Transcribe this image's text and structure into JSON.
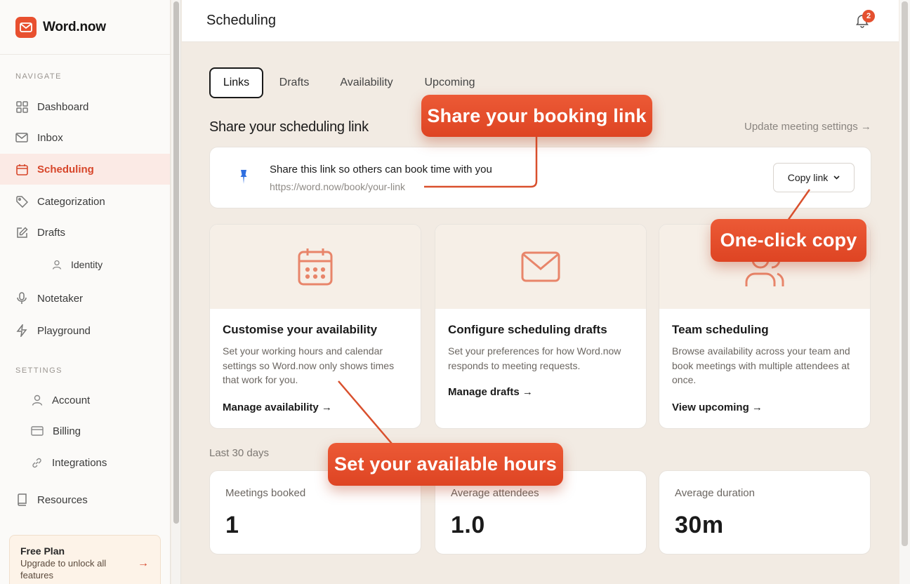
{
  "brand": {
    "name": "Word.now"
  },
  "sidebar": {
    "navigate_label": "NAVIGATE",
    "settings_label": "SETTINGS",
    "items": {
      "dashboard": "Dashboard",
      "inbox": "Inbox",
      "scheduling": "Scheduling",
      "categorization": "Categorization",
      "drafts": "Drafts",
      "identity": "Identity",
      "notetaker": "Notetaker",
      "playground": "Playground",
      "account": "Account",
      "billing": "Billing",
      "integrations": "Integrations",
      "resources": "Resources"
    },
    "free_plan": {
      "title": "Free Plan",
      "subtitle": "Upgrade to unlock all features",
      "arrow": "→"
    }
  },
  "header": {
    "title": "Scheduling",
    "notification_count": "2"
  },
  "tabs": [
    "Links",
    "Drafts",
    "Availability",
    "Upcoming"
  ],
  "share_section": {
    "title": "Share your scheduling link",
    "update_link": "Update meeting settings →",
    "card_title": "Share this link so others can book time with you",
    "link": "https://word.now/book/your-link",
    "copy_label": "Copy link",
    "copy_chevron": "⌄"
  },
  "features": [
    {
      "title": "Customise your availability",
      "description": "Set your working hours and calendar settings so Word.now only shows times that work for you.",
      "link": "Manage availability  →"
    },
    {
      "title": "Configure scheduling drafts",
      "description": "Set your preferences for how Word.now responds to meeting requests.",
      "link": "Manage drafts  →"
    },
    {
      "title": "Team scheduling",
      "description": "Browse availability across your team and book meetings with multiple attendees at once.",
      "link": "View upcoming  →"
    }
  ],
  "stats": {
    "period_label": "Last 30 days",
    "items": [
      {
        "label": "Meetings booked",
        "value": "1"
      },
      {
        "label": "Average attendees",
        "value": "1.0"
      },
      {
        "label": "Average duration",
        "value": "30m"
      }
    ]
  },
  "callouts": {
    "booking": "Share your booking link",
    "copy": "One-click copy",
    "hours": "Set your available hours"
  },
  "colors": {
    "accent": "#e8502f",
    "active_bg": "#fbeae5",
    "icon_orange": "#e8856a",
    "page_bg": "#f2ebe3"
  }
}
